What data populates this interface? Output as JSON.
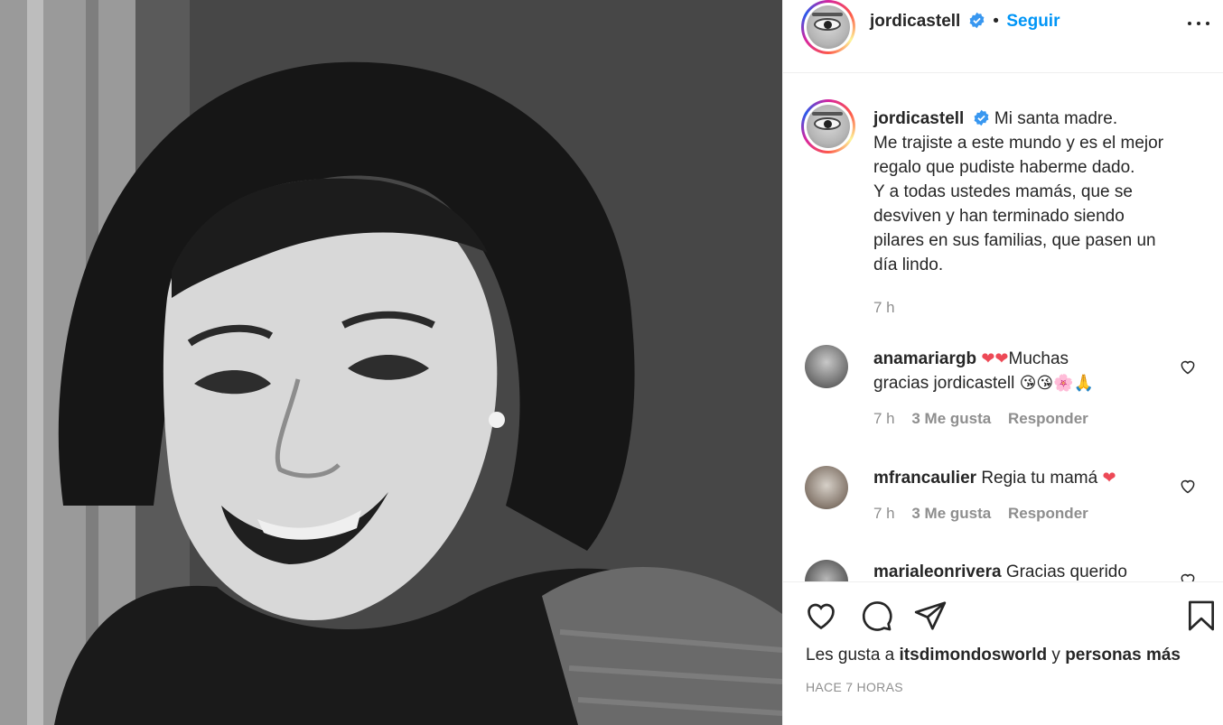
{
  "post": {
    "author": "jordicastell",
    "follow_label": "Seguir",
    "separator": "•",
    "image_alt": "Foto en blanco y negro de una mujer sonriendo"
  },
  "caption": {
    "username": "jordicastell",
    "lines": [
      "Mi santa madre.",
      "Me trajiste a este mundo y es el mejor",
      "regalo que pudiste haberme dado.",
      "Y a todas ustedes mamás, que se",
      "desviven y han terminado siendo",
      "pilares en sus familias, que pasen un",
      "día lindo."
    ],
    "time": "7 h"
  },
  "comments": [
    {
      "username": "anamariargb",
      "text_line1": "Muchas",
      "text_line2": "gracias jordicastell",
      "time": "7 h",
      "likes": "3 Me gusta",
      "reply_label": "Responder"
    },
    {
      "username": "mfrancaulier",
      "text_line1": "Regia tu mamá",
      "time": "7 h",
      "likes": "3 Me gusta",
      "reply_label": "Responder"
    },
    {
      "username": "marialeonrivera",
      "text_line1": "Gracias querido"
    }
  ],
  "likes": {
    "prefix": "Les gusta a",
    "user": "itsdimondosworld",
    "conj": "y",
    "others": "personas más"
  },
  "timestamp": "HACE 7 HORAS",
  "icons": {
    "like": "heart-icon",
    "comment": "comment-icon",
    "share": "share-icon",
    "save": "bookmark-icon",
    "more": "more-options-icon",
    "verified": "verified-badge-icon"
  },
  "colors": {
    "accent": "#0095f6",
    "text": "#262626",
    "muted": "#8e8e8e",
    "heart": "#ed4956",
    "verified": "#3897f0"
  }
}
